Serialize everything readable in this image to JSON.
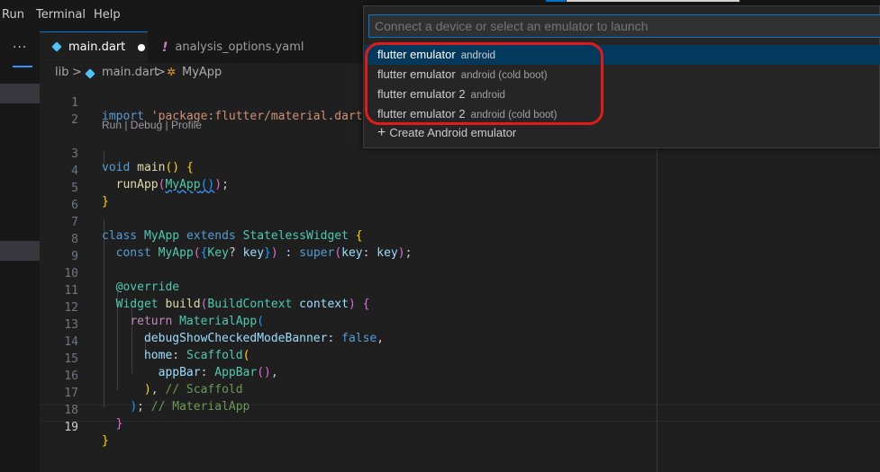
{
  "menubar": {
    "items": [
      "Run",
      "Terminal",
      "Help"
    ]
  },
  "activity": {
    "more": "···"
  },
  "tabs": [
    {
      "label": "main.dart",
      "icon": "dart-icon",
      "active": true
    },
    {
      "label": "analysis_options.yaml",
      "icon": "exclamation-icon",
      "active": false
    }
  ],
  "breadcrumb": {
    "folder": "lib",
    "file": "main.dart",
    "symbol": "MyApp",
    "separator": ">"
  },
  "codelens": "Run | Debug | Profile",
  "line_numbers": [
    "1",
    "2",
    "3",
    "4",
    "5",
    "6",
    "7",
    "8",
    "9",
    "10",
    "11",
    "12",
    "13",
    "14",
    "15",
    "16",
    "17",
    "18",
    "19"
  ],
  "code": {
    "l1": {
      "kw": "import",
      "str": "'package:flutter/material.dart"
    },
    "l3": {
      "kw": "void",
      "fn": "main",
      "p": "()",
      "b": "{"
    },
    "l4": {
      "fn": "runApp",
      "cls": "MyApp",
      "call": "()",
      "end": ");"
    },
    "l5": {
      "b": "}"
    },
    "l7": {
      "kw1": "class",
      "cls1": "MyApp",
      "kw2": "extends",
      "cls2": "StatelessWidget",
      "b": "{"
    },
    "l8": {
      "kw": "const",
      "cls": "MyApp",
      "o1": "(",
      "o2": "{",
      "cls2": "Key",
      "q": "?",
      "pm": "key",
      "c2": "}",
      "c1": ")",
      "colon": " : ",
      "sup": "super",
      "o3": "(",
      "pm2": "key",
      "sep": ": ",
      "pm3": "key",
      "c3": ")",
      "end": ";"
    },
    "l10": {
      "ann": "@override"
    },
    "l11": {
      "cls": "Widget",
      "fn": "build",
      "o": "(",
      "cls2": "BuildContext",
      "pm": "context",
      "c": ")",
      "b": "{"
    },
    "l12": {
      "kw": "return",
      "cls": "MaterialApp",
      "o": "("
    },
    "l13": {
      "pm": "debugShowCheckedModeBanner",
      "sep": ": ",
      "val": "false",
      "end": ","
    },
    "l14": {
      "pm": "home",
      "sep": ": ",
      "cls": "Scaffold",
      "o": "("
    },
    "l15": {
      "pm": "appBar",
      "sep": ": ",
      "cls": "AppBar",
      "call": "()",
      "end": ","
    },
    "l16": {
      "c": ")",
      "end": ", ",
      "cm": "// Scaffold"
    },
    "l17": {
      "c": ")",
      "end": "; ",
      "cm": "// MaterialApp"
    },
    "l18": {
      "b": "}"
    },
    "l19": {
      "b": "}"
    }
  },
  "quickpick": {
    "placeholder": "Connect a device or select an emulator to launch",
    "items": [
      {
        "label": "flutter emulator",
        "desc": "android"
      },
      {
        "label": "flutter emulator",
        "desc": "android (cold boot)"
      },
      {
        "label": "flutter emulator 2",
        "desc": "android"
      },
      {
        "label": "flutter emulator 2",
        "desc": "android (cold boot)"
      }
    ],
    "create": "Create Android emulator",
    "create_icon": "plus-icon"
  },
  "colors": {
    "accent": "#0078d4",
    "annotation": "#e11a1a",
    "selection": "#04395e"
  }
}
